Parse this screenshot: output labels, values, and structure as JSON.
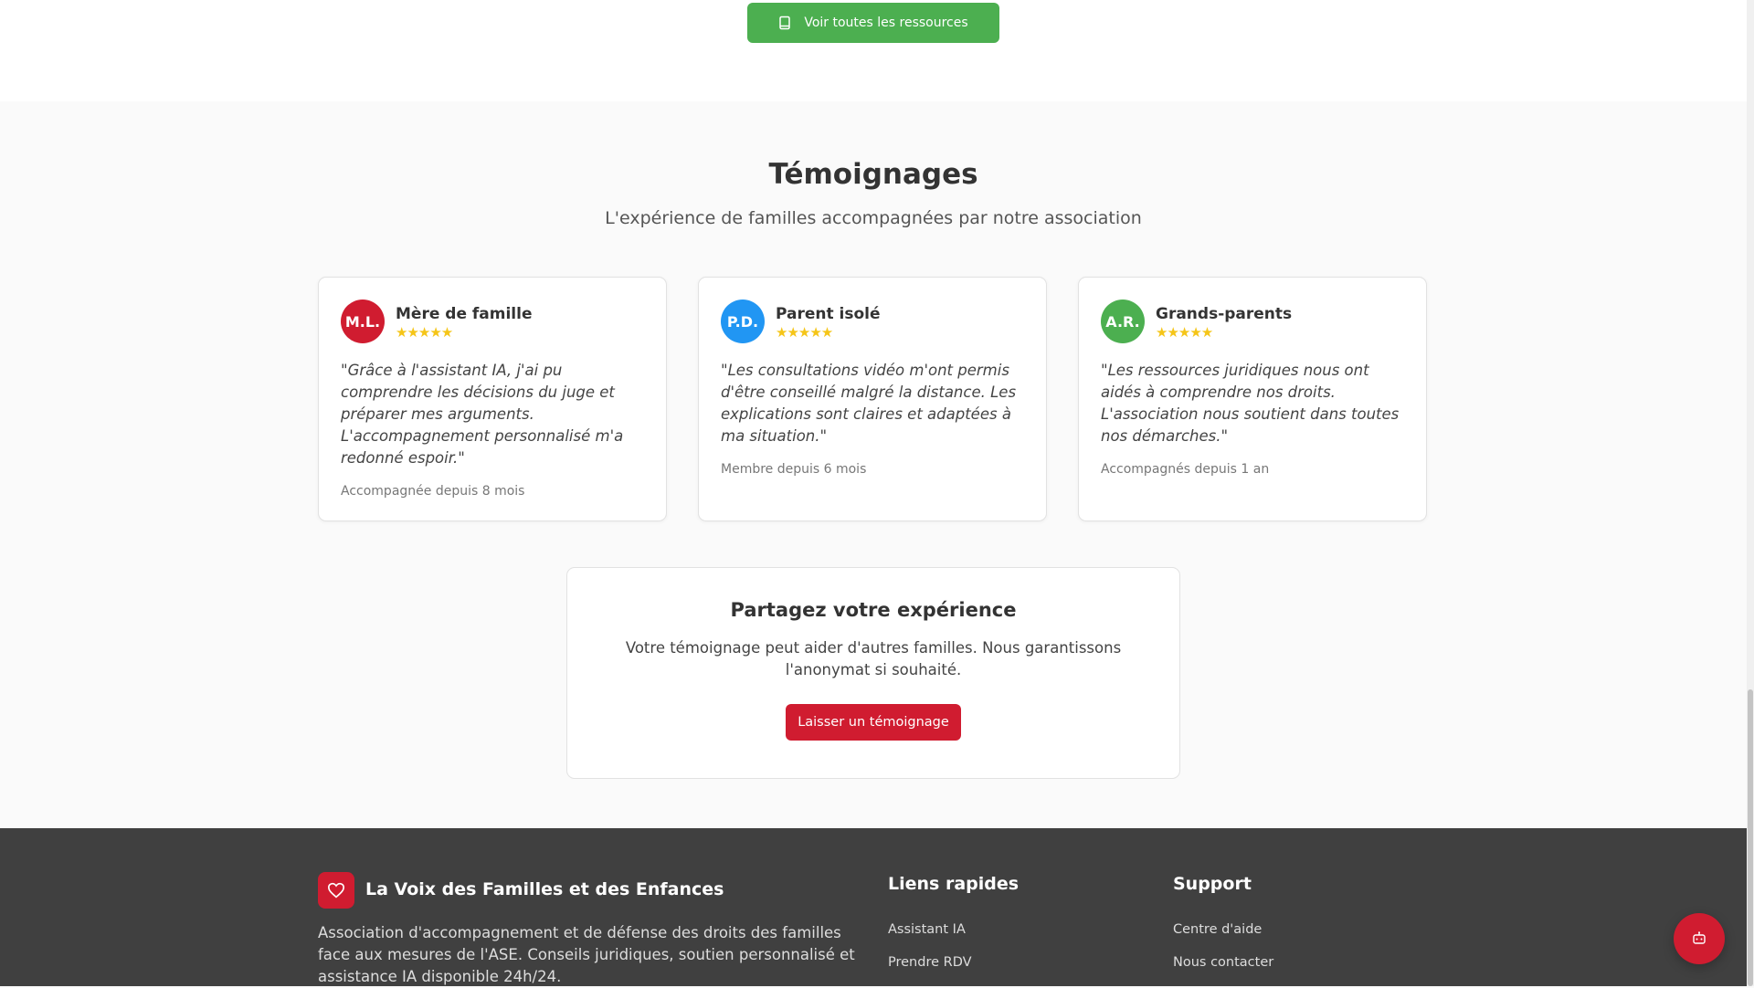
{
  "resources_button": {
    "label": "Voir toutes les ressources",
    "icon": "book-icon"
  },
  "testimonials": {
    "title": "Témoignages",
    "subtitle": "L'expérience de familles accompagnées par notre association",
    "items": [
      {
        "initials": "M.L.",
        "name": "Mère de famille",
        "rating": 5,
        "stars": "★★★★★",
        "quote": "\"Grâce à l'assistant IA, j'ai pu comprendre les décisions du juge et préparer mes arguments. L'accompagnement personnalisé m'a redonné espoir.\"",
        "since": "Accompagnée depuis 8 mois",
        "color": "#d01c30"
      },
      {
        "initials": "P.D.",
        "name": "Parent isolé",
        "rating": 5,
        "stars": "★★★★★",
        "quote": "\"Les consultations vidéo m'ont permis d'être conseillé malgré la distance. Les explications sont claires et adaptées à ma situation.\"",
        "since": "Membre depuis 6 mois",
        "color": "#2196f3"
      },
      {
        "initials": "A.R.",
        "name": "Grands-parents",
        "rating": 5,
        "stars": "★★★★★",
        "quote": "\"Les ressources juridiques nous ont aidés à comprendre nos droits. L'association nous soutient dans toutes nos démarches.\"",
        "since": "Accompagnés depuis 1 an",
        "color": "#4caf50"
      }
    ]
  },
  "share": {
    "title": "Partagez votre expérience",
    "text": "Votre témoignage peut aider d'autres familles. Nous garantissons l'anonymat si souhaité.",
    "button": "Laisser un témoignage"
  },
  "footer": {
    "brand": "La Voix des Familles et des Enfances",
    "logo_icon": "heart-icon",
    "description": "Association d'accompagnement et de défense des droits des familles face aux mesures de l'ASE. Conseils juridiques, soutien personnalisé et assistance IA disponible 24h/24.",
    "quick_links": {
      "title": "Liens rapides",
      "items": [
        "Assistant IA",
        "Prendre RDV"
      ]
    },
    "support": {
      "title": "Support",
      "items": [
        "Centre d'aide",
        "Nous contacter"
      ]
    }
  },
  "chat_button": {
    "icon": "robot-icon"
  },
  "colors": {
    "primary_red": "#d01c30",
    "green": "#4caf50",
    "blue": "#2196f3",
    "star": "#f5c518",
    "footer_bg": "#404040"
  }
}
